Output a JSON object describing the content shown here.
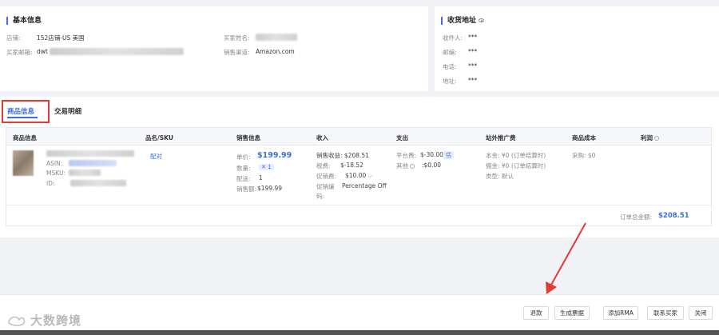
{
  "basic": {
    "title": "基本信息",
    "store_label": "店铺:",
    "store_value": "152店铺-US 美国",
    "buyer_email_label": "买家邮箱:",
    "buyer_email_value": "dwt",
    "buyer_name_label": "买家姓名:",
    "channel_label": "销售渠道:",
    "channel_value": "Amazon.com"
  },
  "address": {
    "title": "收货地址",
    "recipient_label": "收件人:",
    "recipient_value": "***",
    "zip_label": "邮编:",
    "zip_value": "***",
    "phone_label": "电话:",
    "phone_value": "***",
    "addr_label": "地址:",
    "addr_value": "***"
  },
  "tabs": [
    {
      "label": "商品信息",
      "active": true
    },
    {
      "label": "交易明细",
      "active": false
    }
  ],
  "table": {
    "headers": [
      "商品信息",
      "品名/SKU",
      "销售信息",
      "收入",
      "支出",
      "站外推广费",
      "商品成本",
      "利润"
    ],
    "product": {
      "asin_label": "ASIN:",
      "msku_label": "MSKU:",
      "id_label": "ID:"
    },
    "sku_link": "配对",
    "sales": {
      "price_label": "单价:",
      "price_value": "$199.99",
      "qty_label": "数量:",
      "qty_value": "✕ 1",
      "ship_label": "配送:",
      "ship_value": "1",
      "total_label": "销售额:",
      "total_value": "$199.99"
    },
    "income": {
      "sales_income": "销售收益: $208.51",
      "tax_label": "税费:",
      "tax_value": "$-18.52",
      "promo_label": "促销费:",
      "promo_value": "$10.00",
      "promo_code_label": "促销编码:",
      "promo_code_value": "Percentage Off"
    },
    "expense": {
      "platform_label": "平台费:",
      "platform_value": "$-30.00",
      "platform_badge": "估",
      "other_label": "其他",
      "other_value": ":$0.00"
    },
    "promo_fee": {
      "base": "本金: ¥0 (订单结算时)",
      "commission": "佣金: ¥0 (订单结算时)",
      "type": "类型: 默认"
    },
    "cost": "采购: $0",
    "order_total_label": "订单总金额:",
    "order_total_value": "$208.51"
  },
  "footer": {
    "buttons": [
      "退款",
      "生成票据",
      "添加RMA",
      "联系买家",
      "关闭"
    ],
    "watermark": "大数跨境"
  },
  "colors": {
    "accent": "#3b6fe0",
    "highlight": "#e53935"
  }
}
